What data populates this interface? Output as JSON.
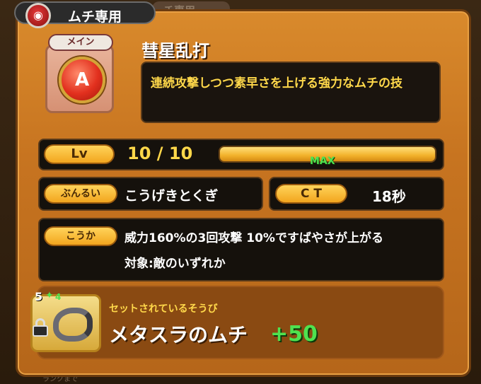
{
  "colors": {
    "accent": "#f2a51e",
    "green": "#4fe24f",
    "yellow_text": "#ffd84a",
    "panel": "#c77420"
  },
  "background": {
    "tab_label": "チ専用",
    "bottom_text": "ランクまで"
  },
  "header": {
    "title": "ムチ専用",
    "emblem_icon": "whip-emblem-icon"
  },
  "skill": {
    "badge": "メイン",
    "letter": "A",
    "name": "彗星乱打",
    "description": "連続攻撃しつつ素早さを上げる強力なムチの技"
  },
  "level": {
    "label": "Lv",
    "value": "10 / 10",
    "progress": 1.0,
    "max_label": "MAX"
  },
  "attr": {
    "label": "ぶんるい",
    "value": "こうげきとくぎ"
  },
  "ct": {
    "label": "C T",
    "value": "18秒"
  },
  "effect": {
    "label": "こうか",
    "line1": "威力160%の3回攻撃 10%ですばやさが上がる",
    "line2": "対象:敵のいずれか"
  },
  "equip": {
    "rank": "5",
    "plus": "4",
    "caption": "セットされているそうび",
    "name": "メタスラのムチ",
    "bonus": "+50"
  }
}
